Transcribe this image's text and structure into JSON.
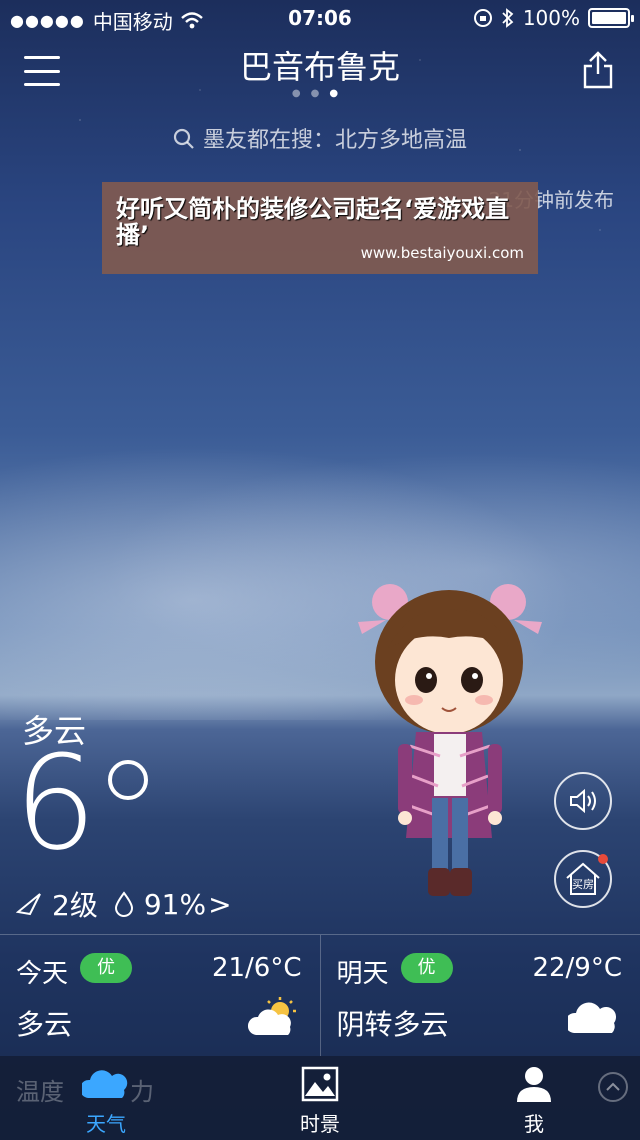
{
  "status_bar": {
    "signal_dots": "●●●●●",
    "carrier": "中国移动",
    "time": "07:06",
    "battery_pct": "100%",
    "battery_level": 1.0
  },
  "header": {
    "city": "巴音布鲁克",
    "pages": {
      "total": 3,
      "current": 3
    }
  },
  "search": {
    "text": "墨友都在搜：北方多地高温"
  },
  "publish_time": "21分钟前发布",
  "banner": {
    "title": "好听又简朴的装修公司起名‘爱游戏直播’",
    "url": "www.bestaiyouxi.com"
  },
  "current": {
    "condition": "多云",
    "temperature": "6",
    "wind_level": "2级",
    "humidity": "91%",
    "humidity_arrow": ">"
  },
  "side_buttons": {
    "house_label": "买房"
  },
  "forecast": [
    {
      "day": "今天",
      "aqi": "优",
      "range": "21/6°C",
      "condition": "多云",
      "icon": "sun-cloud-icon"
    },
    {
      "day": "明天",
      "aqi": "优",
      "range": "22/9°C",
      "condition": "阴转多云",
      "icon": "cloud-icon"
    }
  ],
  "bottom_overlay": {
    "left": "温度",
    "right": "力"
  },
  "tabs": [
    {
      "label": "天气",
      "icon": "cloud-icon",
      "active": true
    },
    {
      "label": "时景",
      "icon": "photo-icon",
      "active": false
    },
    {
      "label": "我",
      "icon": "person-icon",
      "active": false
    }
  ],
  "colors": {
    "aqi_good": "#3fbe55",
    "tab_active": "#3ba7ff",
    "notification": "#e84a3a"
  }
}
